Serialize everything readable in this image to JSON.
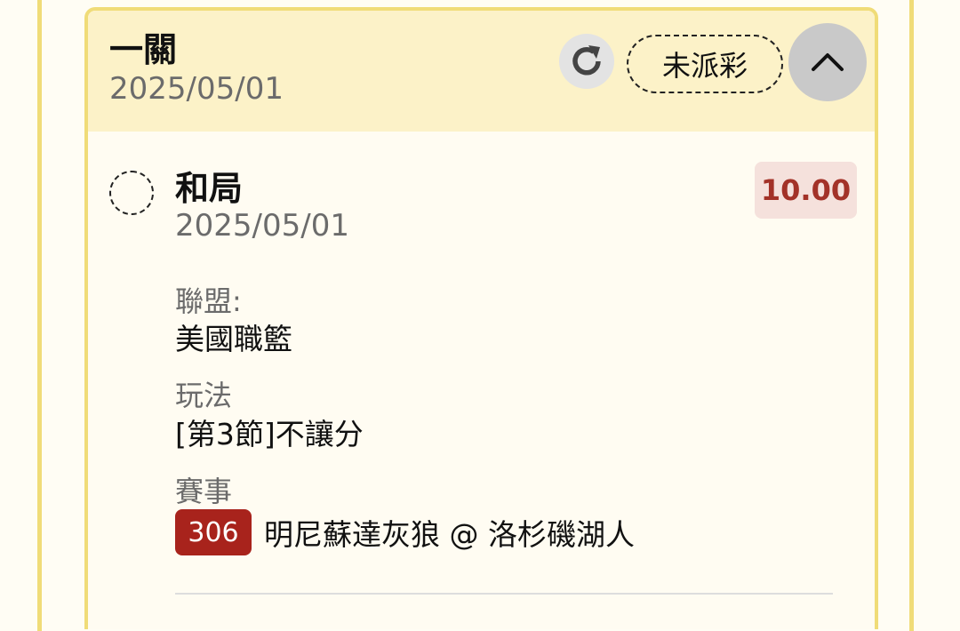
{
  "header": {
    "title": "一關",
    "date": "2025/05/01",
    "status": "未派彩"
  },
  "icons": {
    "refresh": "refresh-icon",
    "collapse": "chevron-up-icon"
  },
  "selection": {
    "title": "和局",
    "date": "2025/05/01",
    "odds": "10.00",
    "league_label": "聯盟:",
    "league_value": "美國職籃",
    "bet_type_label": "玩法",
    "bet_type_value": "[第3節]不讓分",
    "event_label": "賽事",
    "event_number": "306",
    "event_name": "明尼蘇達灰狼 @ 洛杉磯湖人"
  },
  "colors": {
    "header_bg": "#fcf2c8",
    "border": "#f0dc78",
    "odds_text": "#a33228",
    "odds_bg": "#f5e1dc",
    "event_badge": "#a8231c"
  }
}
